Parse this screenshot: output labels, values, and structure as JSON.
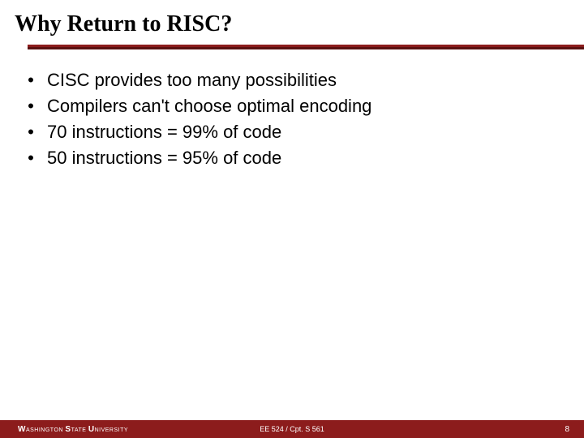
{
  "title": "Why Return to RISC?",
  "bullets": [
    "CISC provides too many possibilities",
    "Compilers can't choose optimal encoding",
    "70 instructions = 99% of code",
    "50 instructions = 95% of code"
  ],
  "footer": {
    "institution_w": "W",
    "institution_ashington": "ASHINGTON ",
    "institution_s": "S",
    "institution_tate": "TATE ",
    "institution_u": "U",
    "institution_niversity": "NIVERSITY",
    "course": "EE 524 / Cpt. S 561",
    "page": "8"
  }
}
